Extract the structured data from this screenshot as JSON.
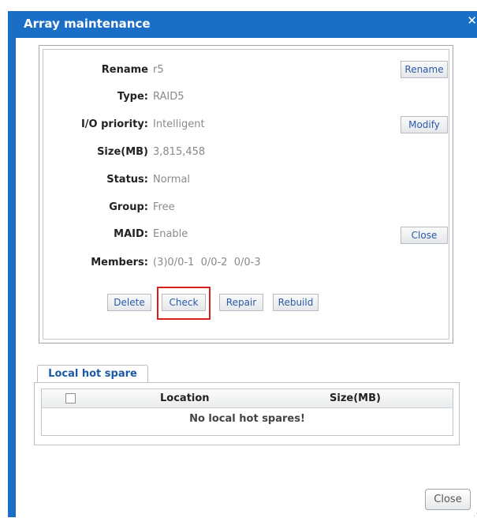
{
  "window": {
    "title": "Array maintenance",
    "close_glyph": "✕"
  },
  "array_info": {
    "rename": {
      "label": "Rename",
      "value": "r5",
      "button": "Rename"
    },
    "type": {
      "label": "Type:",
      "value": "RAID5"
    },
    "io_priority": {
      "label": "I/O priority:",
      "value": "Intelligent",
      "button": "Modify"
    },
    "size": {
      "label": "Size(MB)",
      "value": "3,815,458"
    },
    "status": {
      "label": "Status:",
      "value": "Normal"
    },
    "group": {
      "label": "Group:",
      "value": "Free"
    },
    "maid": {
      "label": "MAID:",
      "value": "Enable",
      "button": "Close"
    },
    "members": {
      "label": "Members:",
      "value": "(3)0/0-1  0/0-2  0/0-3"
    }
  },
  "actions": {
    "delete": "Delete",
    "check": "Check",
    "repair": "Repair",
    "rebuild": "Rebuild"
  },
  "hot_spare": {
    "tab_label": "Local hot spare",
    "columns": {
      "location": "Location",
      "size": "Size(MB)"
    },
    "empty_message": "No local hot spares!"
  },
  "footer": {
    "close": "Close"
  },
  "colors": {
    "title_bar": "#1a6ec6",
    "highlight": "#d6201e",
    "link_text": "#2a5aa8"
  }
}
